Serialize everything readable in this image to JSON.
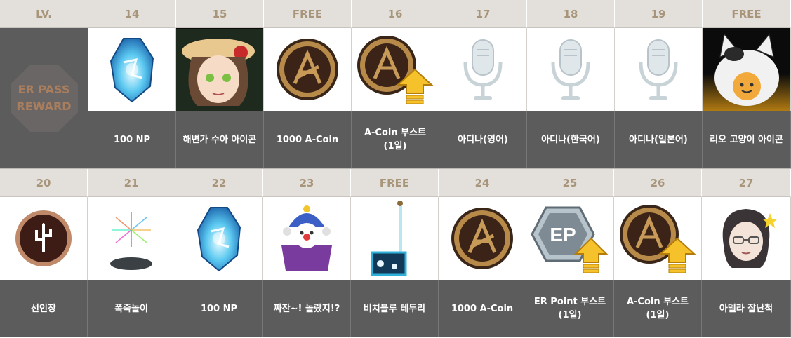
{
  "side": {
    "header": "LV.",
    "badge": "ER PASS\nREWARD"
  },
  "row1": [
    {
      "level": "14",
      "reward": "100 NP",
      "icon": "np-crystal-icon"
    },
    {
      "level": "15",
      "reward": "해변가 수아 아이콘",
      "icon": "sua-beach-portrait-icon"
    },
    {
      "level": "FREE",
      "reward": "1000 A-Coin",
      "icon": "a-coin-icon"
    },
    {
      "level": "16",
      "reward": "A-Coin 부스트\n(1일)",
      "icon": "a-coin-boost-icon"
    },
    {
      "level": "17",
      "reward": "아디나(영어)",
      "icon": "microphone-icon"
    },
    {
      "level": "18",
      "reward": "아디나(한국어)",
      "icon": "microphone-icon"
    },
    {
      "level": "19",
      "reward": "아디나(일본어)",
      "icon": "microphone-icon"
    },
    {
      "level": "FREE",
      "reward": "리오 고양이 아이콘",
      "icon": "rio-cat-icon"
    }
  ],
  "row2": [
    {
      "level": "20",
      "reward": "선인장",
      "icon": "cactus-emblem-icon"
    },
    {
      "level": "21",
      "reward": "폭죽놀이",
      "icon": "fireworks-icon"
    },
    {
      "level": "22",
      "reward": "100 NP",
      "icon": "np-crystal-icon"
    },
    {
      "level": "23",
      "reward": "짜잔~! 놀랐지!?",
      "icon": "jester-box-icon"
    },
    {
      "level": "FREE",
      "reward": "비치블루 테두리",
      "icon": "beach-blue-frame-icon"
    },
    {
      "level": "24",
      "reward": "1000 A-Coin",
      "icon": "a-coin-icon"
    },
    {
      "level": "25",
      "reward": "ER Point 부스트\n(1일)",
      "icon": "er-point-boost-icon"
    },
    {
      "level": "26",
      "reward": "A-Coin 부스트\n(1일)",
      "icon": "a-coin-boost-icon"
    },
    {
      "level": "27",
      "reward": "아델라 잘난척",
      "icon": "adela-portrait-icon"
    }
  ],
  "colors": {
    "header_bg": "#e3e0dc",
    "header_text": "#a8957a",
    "label_bg": "#5c5c5c",
    "badge_text": "#a87e5e"
  }
}
